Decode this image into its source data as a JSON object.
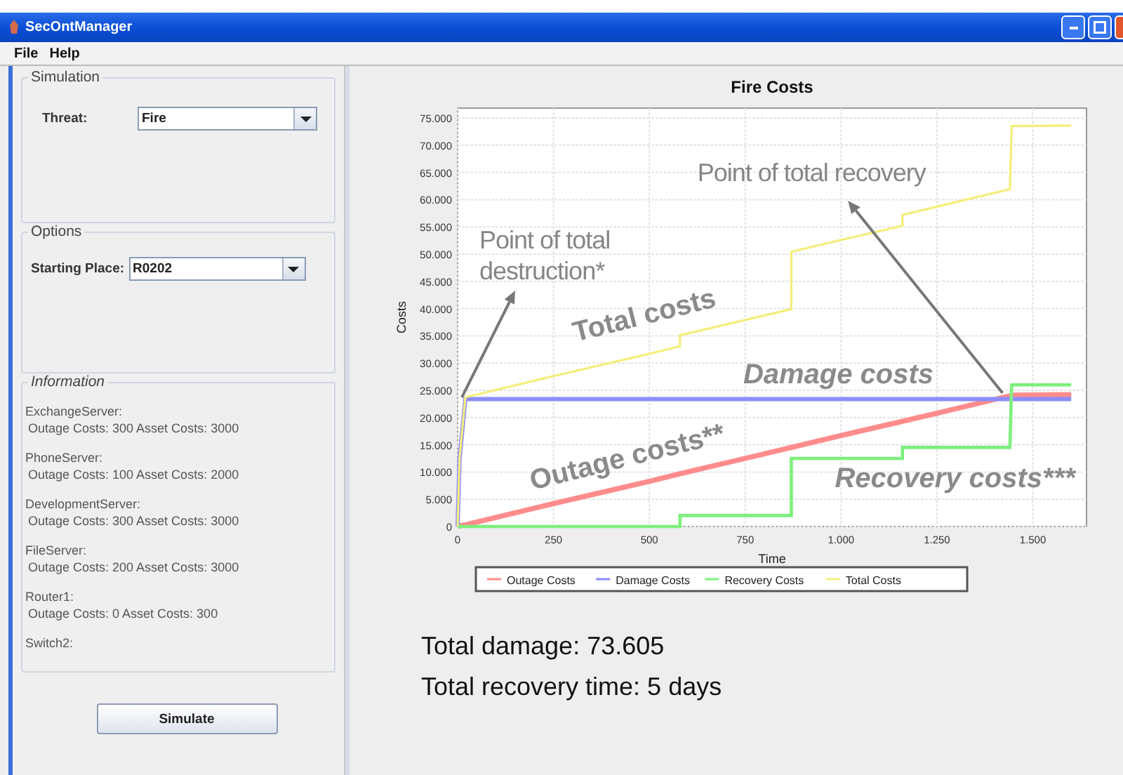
{
  "window": {
    "title": "SecOntManager"
  },
  "menu": [
    {
      "label": "File"
    },
    {
      "label": "Help"
    }
  ],
  "simulation": {
    "title": "Simulation",
    "threat_label": "Threat:",
    "threat_value": "Fire"
  },
  "options": {
    "title": "Options",
    "starting_place_label": "Starting Place:",
    "starting_place_value": "R0202"
  },
  "information": {
    "title": "Information",
    "items": [
      {
        "name": "ExchangeServer:",
        "details": "Outage Costs: 300 Asset Costs: 3000"
      },
      {
        "name": "PhoneServer:",
        "details": "Outage Costs: 100 Asset Costs: 2000"
      },
      {
        "name": "DevelopmentServer:",
        "details": "Outage Costs: 300 Asset Costs: 3000"
      },
      {
        "name": "FileServer:",
        "details": "Outage Costs: 200 Asset Costs: 3000"
      },
      {
        "name": "Router1:",
        "details": "Outage Costs: 0 Asset Costs: 300"
      },
      {
        "name": "Switch2:"
      }
    ]
  },
  "simulate_button": "Simulate",
  "chart": {
    "chart_data": {
      "type": "line",
      "title": "Fire Costs",
      "xlabel": "Time",
      "ylabel": "Costs",
      "x": [
        0,
        5,
        20,
        250,
        500,
        580,
        580,
        750,
        870,
        870,
        1000,
        1160,
        1160,
        1250,
        1440,
        1445,
        1600
      ],
      "series": [
        {
          "name": "Outage Costs",
          "color": "#ff8c8c",
          "values": [
            0,
            100,
            300,
            4200,
            8300,
            9700,
            9700,
            12500,
            14500,
            14500,
            16700,
            19300,
            19300,
            20800,
            24000,
            24100,
            24200
          ]
        },
        {
          "name": "Damage Costs",
          "color": "#8c8cff",
          "values": [
            0,
            12500,
            23400,
            23400,
            23400,
            23400,
            23400,
            23400,
            23400,
            23400,
            23400,
            23400,
            23400,
            23400,
            23400,
            23400,
            23400
          ]
        },
        {
          "name": "Recovery Costs",
          "color": "#7cf07c",
          "values": [
            0,
            0,
            0,
            0,
            0,
            0,
            2000,
            2000,
            2000,
            12500,
            12500,
            12500,
            14500,
            14500,
            14500,
            26000,
            26000
          ]
        },
        {
          "name": "Total Costs",
          "color": "#f4ee7a",
          "values": [
            0,
            12600,
            23700,
            27600,
            31700,
            33100,
            35100,
            37900,
            39900,
            50400,
            52600,
            55200,
            57200,
            58700,
            61900,
            73500,
            73600
          ]
        }
      ],
      "xlim": [
        0,
        1640
      ],
      "ylim": [
        0,
        76800
      ],
      "xticks": [
        {
          "value": 0,
          "label": "0"
        },
        {
          "value": 250,
          "label": "250"
        },
        {
          "value": 500,
          "label": "500"
        },
        {
          "value": 750,
          "label": "750"
        },
        {
          "value": 1000,
          "label": "1.000"
        },
        {
          "value": 1250,
          "label": "1.250"
        },
        {
          "value": 1500,
          "label": "1.500"
        }
      ],
      "yticks": [
        {
          "value": 0,
          "label": "0"
        },
        {
          "value": 5000,
          "label": "5.000"
        },
        {
          "value": 10000,
          "label": "10.000"
        },
        {
          "value": 15000,
          "label": "15.000"
        },
        {
          "value": 20000,
          "label": "20.000"
        },
        {
          "value": 25000,
          "label": "25.000"
        },
        {
          "value": 30000,
          "label": "30.000"
        },
        {
          "value": 35000,
          "label": "35.000"
        },
        {
          "value": 40000,
          "label": "40.000"
        },
        {
          "value": 45000,
          "label": "45.000"
        },
        {
          "value": 50000,
          "label": "50.000"
        },
        {
          "value": 55000,
          "label": "55.000"
        },
        {
          "value": 60000,
          "label": "60.000"
        },
        {
          "value": 65000,
          "label": "65.000"
        },
        {
          "value": 70000,
          "label": "70.000"
        },
        {
          "value": 75000,
          "label": "75.000"
        }
      ],
      "grid": true,
      "legend": true,
      "annotations": [
        "Point of total recovery",
        "Point of total destruction*",
        "Total costs",
        "Damage costs",
        "Outage costs**",
        "Recovery costs***"
      ]
    }
  },
  "summary": [
    "Total damage: 73.605",
    "Total recovery time: 5 days"
  ]
}
